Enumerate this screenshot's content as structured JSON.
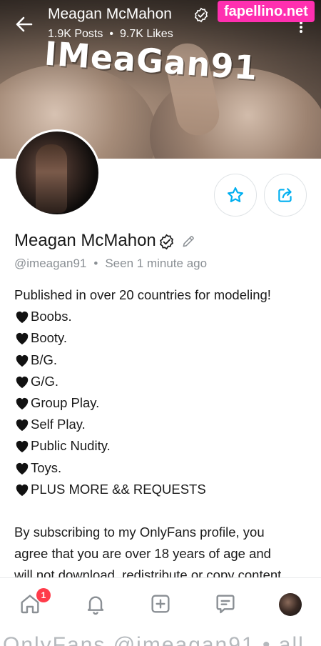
{
  "header": {
    "name": "Meagan McMahon",
    "posts": "1.9K Posts",
    "likes": "9.7K Likes",
    "separator": "•"
  },
  "banner": {
    "watermark_text": "IMeaGan91"
  },
  "site_watermark": "fapellino.net",
  "profile": {
    "name": "Meagan McMahon",
    "handle": "@imeagan91",
    "separator": "•",
    "last_seen": "Seen 1 minute ago"
  },
  "bio": {
    "intro": "Published in over 20 countries for modeling!",
    "items": [
      "Boobs.",
      "Booty.",
      "B/G.",
      "G/G.",
      "Group Play.",
      "Self Play.",
      "Public Nudity.",
      "Toys.",
      "PLUS MORE && REQUESTS"
    ],
    "paragraph_lines": [
      "By subscribing to my OnlyFans profile, you",
      "agree that you are over 18 years of age and",
      "will not download, redistribute or copy content"
    ]
  },
  "bottom_nav": {
    "notification_badge": "1",
    "items": [
      "home-icon",
      "bell-icon",
      "add-post-icon",
      "messages-icon",
      "profile-avatar"
    ]
  },
  "cutoff_text": "OnlyFans @imeagan91 • all",
  "colors": {
    "accent": "#00aff0",
    "badge": "#ff3b4a",
    "watermark_bg": "#ff2fb0",
    "muted_text": "#8a8f94"
  }
}
